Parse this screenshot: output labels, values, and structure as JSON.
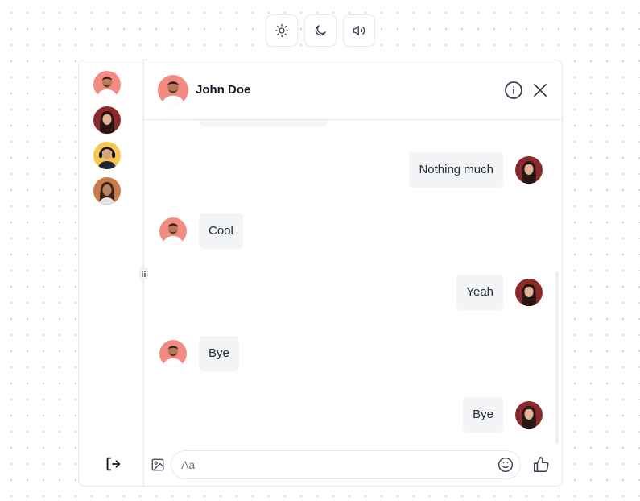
{
  "toolbar": {
    "items": [
      {
        "icon": "sun-icon"
      },
      {
        "icon": "moon-icon"
      },
      {
        "icon": "volume-icon"
      }
    ]
  },
  "sidebar": {
    "contacts": [
      {
        "avatar": "man-avatar",
        "color": "#f28b82"
      },
      {
        "avatar": "woman-avatar",
        "color": "#8b2a2a"
      },
      {
        "avatar": "headphones-avatar",
        "color": "#f9c74f"
      },
      {
        "avatar": "woman-smiling-avatar",
        "color": "#c97b4a"
      }
    ],
    "logout_icon": "logout-icon"
  },
  "header": {
    "contact_name": "John Doe",
    "info_icon": "info-icon",
    "close_icon": "close-icon"
  },
  "messages": [
    {
      "from": "them",
      "text": ""
    },
    {
      "from": "me",
      "text": "Nothing much"
    },
    {
      "from": "them",
      "text": "Cool"
    },
    {
      "from": "me",
      "text": "Yeah"
    },
    {
      "from": "them",
      "text": "Bye"
    },
    {
      "from": "me",
      "text": "Bye"
    }
  ],
  "composer": {
    "placeholder": "Aa",
    "value": "",
    "image_icon": "image-icon",
    "emoji_icon": "smile-icon",
    "like_icon": "thumbs-up-icon"
  },
  "colors": {
    "bubble_bg": "#f3f4f6",
    "border": "#e5e7eb",
    "man_avatar_bg": "#f28b82",
    "woman_avatar_bg": "#8b2a2a"
  }
}
